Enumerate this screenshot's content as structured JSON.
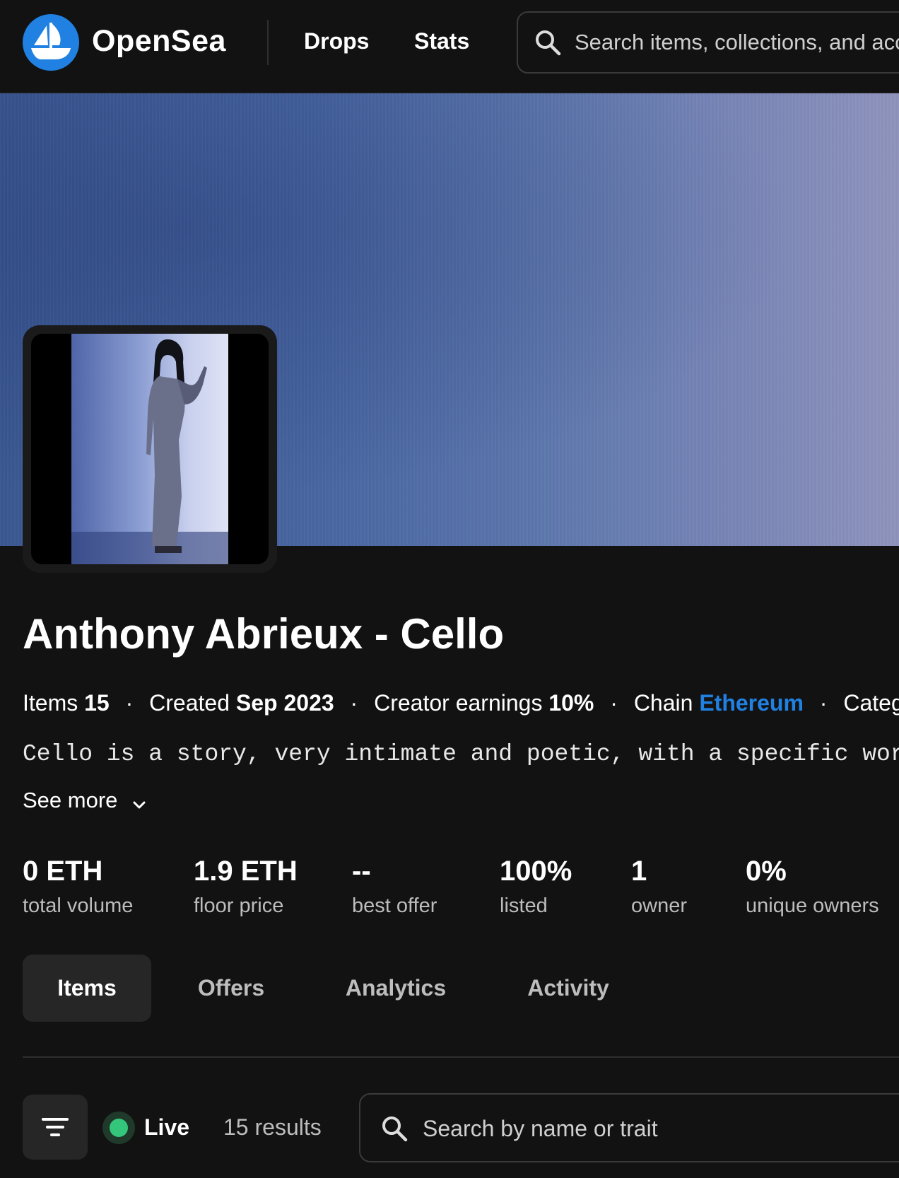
{
  "header": {
    "brand": "OpenSea",
    "nav": {
      "drops": "Drops",
      "stats": "Stats"
    },
    "search_placeholder": "Search items, collections, and accounts"
  },
  "collection": {
    "title": "Anthony Abrieux - Cello",
    "meta": {
      "items_label": "Items",
      "items_value": "15",
      "created_label": "Created",
      "created_value": "Sep 2023",
      "earnings_label": "Creator earnings",
      "earnings_value": "10%",
      "chain_label": "Chain",
      "chain_value": "Ethereum",
      "category_label": "Category"
    },
    "description": "Cello is a story, very intimate and poetic, with a specific work on light and",
    "see_more": "See more"
  },
  "stats": [
    {
      "value": "0 ETH",
      "label": "total volume"
    },
    {
      "value": "1.9 ETH",
      "label": "floor price"
    },
    {
      "value": "--",
      "label": "best offer"
    },
    {
      "value": "100%",
      "label": "listed"
    },
    {
      "value": "1",
      "label": "owner"
    },
    {
      "value": "0%",
      "label": "unique owners"
    }
  ],
  "tabs": [
    {
      "label": "Items",
      "active": true
    },
    {
      "label": "Offers",
      "active": false
    },
    {
      "label": "Analytics",
      "active": false
    },
    {
      "label": "Activity",
      "active": false
    }
  ],
  "filter_bar": {
    "live_label": "Live",
    "results": "15 results",
    "search_placeholder": "Search by name or trait"
  },
  "colors": {
    "accent": "#2081E2",
    "live": "#34c77b",
    "background": "#121212"
  }
}
